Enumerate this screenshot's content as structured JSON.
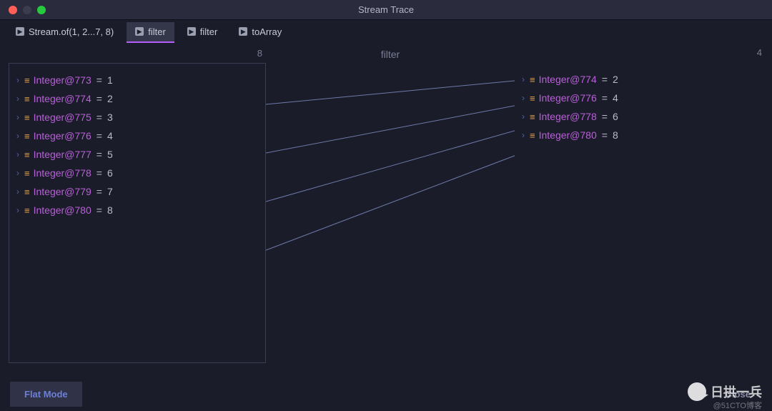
{
  "window": {
    "title": "Stream Trace"
  },
  "tabs": [
    {
      "label": "Stream.of(1, 2...7, 8)",
      "active": false
    },
    {
      "label": "filter",
      "active": true
    },
    {
      "label": "filter",
      "active": false
    },
    {
      "label": "toArray",
      "active": false
    }
  ],
  "left": {
    "count": "8",
    "items": [
      {
        "ref": "Integer@773",
        "value": "1"
      },
      {
        "ref": "Integer@774",
        "value": "2"
      },
      {
        "ref": "Integer@775",
        "value": "3"
      },
      {
        "ref": "Integer@776",
        "value": "4"
      },
      {
        "ref": "Integer@777",
        "value": "5"
      },
      {
        "ref": "Integer@778",
        "value": "6"
      },
      {
        "ref": "Integer@779",
        "value": "7"
      },
      {
        "ref": "Integer@780",
        "value": "8"
      }
    ]
  },
  "mid": {
    "label": "filter"
  },
  "right": {
    "count": "4",
    "items": [
      {
        "ref": "Integer@774",
        "value": "2"
      },
      {
        "ref": "Integer@776",
        "value": "4"
      },
      {
        "ref": "Integer@778",
        "value": "6"
      },
      {
        "ref": "Integer@780",
        "value": "8"
      }
    ]
  },
  "mapping": [
    {
      "from": 1,
      "to": 0
    },
    {
      "from": 3,
      "to": 1
    },
    {
      "from": 5,
      "to": 2
    },
    {
      "from": 7,
      "to": 3
    }
  ],
  "footer": {
    "flat_label": "Flat Mode",
    "close_label": "Close"
  },
  "watermark": {
    "text": "日拱一兵",
    "sub": "@51CTO博客"
  },
  "eq": "="
}
